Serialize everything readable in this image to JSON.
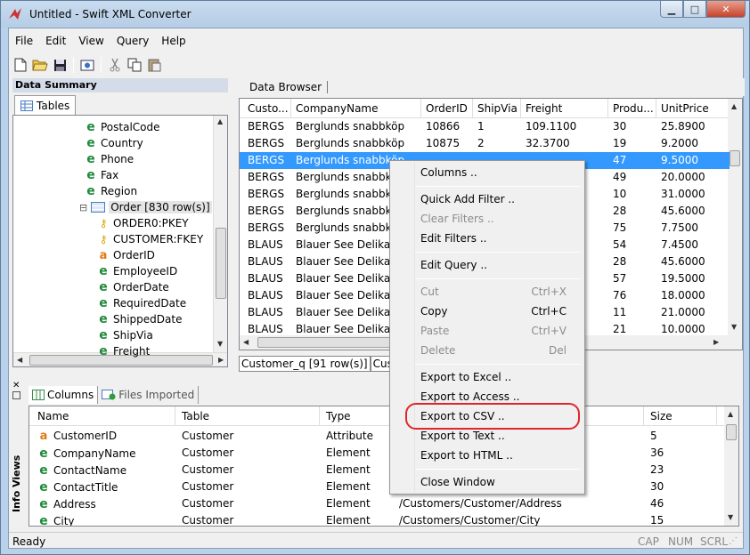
{
  "window": {
    "title": "Untitled - Swift XML Converter"
  },
  "menu": [
    "File",
    "Edit",
    "View",
    "Query",
    "Help"
  ],
  "left_panel": {
    "header": "Data Summary",
    "tab": "Tables",
    "tree": [
      {
        "icon": "element",
        "label": "PostalCode"
      },
      {
        "icon": "element",
        "label": "Country"
      },
      {
        "icon": "element",
        "label": "Phone"
      },
      {
        "icon": "element",
        "label": "Fax"
      },
      {
        "icon": "element",
        "label": "Region"
      },
      {
        "icon": "table",
        "label": "Order [830 row(s)]"
      },
      {
        "icon": "key",
        "label": "ORDER0:PKEY"
      },
      {
        "icon": "key",
        "label": "CUSTOMER:FKEY"
      },
      {
        "icon": "attribute",
        "label": "OrderID"
      },
      {
        "icon": "element",
        "label": "EmployeeID"
      },
      {
        "icon": "element",
        "label": "OrderDate"
      },
      {
        "icon": "element",
        "label": "RequiredDate"
      },
      {
        "icon": "element",
        "label": "ShippedDate"
      },
      {
        "icon": "element",
        "label": "ShipVia"
      },
      {
        "icon": "element",
        "label": "Freight"
      }
    ]
  },
  "data_browser": {
    "tab": "Data Browser",
    "columns": [
      "Custo...",
      "CompanyName",
      "OrderID",
      "ShipVia",
      "Freight",
      "Produ...",
      "UnitPrice"
    ],
    "rows": [
      [
        "BERGS",
        "Berglunds snabbköp",
        "10866",
        "1",
        "109.1100",
        "30",
        "25.8900"
      ],
      [
        "BERGS",
        "Berglunds snabbköp",
        "10875",
        "2",
        "32.3700",
        "19",
        "9.2000"
      ],
      [
        "BERGS",
        "Berglunds snabbköp",
        "",
        "",
        "",
        "47",
        "9.5000"
      ],
      [
        "BERGS",
        "Berglunds snabbköp",
        "",
        "",
        "",
        "49",
        "20.0000"
      ],
      [
        "BERGS",
        "Berglunds snabbköp",
        "",
        "",
        "",
        "10",
        "31.0000"
      ],
      [
        "BERGS",
        "Berglunds snabbköp",
        "",
        "",
        "",
        "28",
        "45.6000"
      ],
      [
        "BERGS",
        "Berglunds snabbköp",
        "",
        "",
        "",
        "75",
        "7.7500"
      ],
      [
        "BLAUS",
        "Blauer See Delikatess",
        "",
        "",
        "",
        "54",
        "7.4500"
      ],
      [
        "BLAUS",
        "Blauer See Delikatess",
        "",
        "",
        "",
        "28",
        "45.6000"
      ],
      [
        "BLAUS",
        "Blauer See Delikatess",
        "",
        "",
        "",
        "57",
        "19.5000"
      ],
      [
        "BLAUS",
        "Blauer See Delikatess",
        "",
        "",
        "",
        "76",
        "18.0000"
      ],
      [
        "BLAUS",
        "Blauer See Delikatess",
        "",
        "",
        "",
        "11",
        "21.0000"
      ],
      [
        "BLAUS",
        "Blauer See Delikatess",
        "",
        "",
        "",
        "21",
        "10.0000"
      ]
    ],
    "selected_row": 2,
    "bottom_tabs": [
      "Customer_q [91 row(s)]",
      "Customer"
    ]
  },
  "info_views": {
    "label": "Info Views",
    "tabs": [
      "Columns",
      "Files Imported"
    ],
    "columns": [
      "Name",
      "Table",
      "Type",
      "",
      "Size"
    ],
    "rows": [
      {
        "icon": "attribute",
        "name": "CustomerID",
        "table": "Customer",
        "type": "Attribute",
        "path": "",
        "size": "5"
      },
      {
        "icon": "element",
        "name": "CompanyName",
        "table": "Customer",
        "type": "Element",
        "path": "",
        "size": "36"
      },
      {
        "icon": "element",
        "name": "ContactName",
        "table": "Customer",
        "type": "Element",
        "path": "",
        "size": "23"
      },
      {
        "icon": "element",
        "name": "ContactTitle",
        "table": "Customer",
        "type": "Element",
        "path": "",
        "size": "30"
      },
      {
        "icon": "element",
        "name": "Address",
        "table": "Customer",
        "type": "Element",
        "path": "/Customers/Customer/Address",
        "size": "46"
      },
      {
        "icon": "element",
        "name": "City",
        "table": "Customer",
        "type": "Element",
        "path": "/Customers/Customer/City",
        "size": "15"
      }
    ]
  },
  "status": {
    "text": "Ready",
    "indicators": [
      "CAP",
      "NUM",
      "SCRL"
    ]
  },
  "context_menu": {
    "items": [
      {
        "label": "Columns ..",
        "shortcut": "",
        "enabled": true
      },
      {
        "sep": true
      },
      {
        "label": "Quick Add Filter ..",
        "shortcut": "",
        "enabled": true
      },
      {
        "label": "Clear Filters ..",
        "shortcut": "",
        "enabled": false
      },
      {
        "label": "Edit Filters ..",
        "shortcut": "",
        "enabled": true
      },
      {
        "sep": true
      },
      {
        "label": "Edit Query ..",
        "shortcut": "",
        "enabled": true
      },
      {
        "sep": true
      },
      {
        "label": "Cut",
        "shortcut": "Ctrl+X",
        "enabled": false
      },
      {
        "label": "Copy",
        "shortcut": "Ctrl+C",
        "enabled": true
      },
      {
        "label": "Paste",
        "shortcut": "Ctrl+V",
        "enabled": false
      },
      {
        "label": "Delete",
        "shortcut": "Del",
        "enabled": false
      },
      {
        "sep": true
      },
      {
        "label": "Export to Excel ..",
        "shortcut": "",
        "enabled": true
      },
      {
        "label": "Export to Access ..",
        "shortcut": "",
        "enabled": true
      },
      {
        "label": "Export to CSV ..",
        "shortcut": "",
        "enabled": true
      },
      {
        "label": "Export to Text ..",
        "shortcut": "",
        "enabled": true
      },
      {
        "label": "Export to HTML ..",
        "shortcut": "",
        "enabled": true
      },
      {
        "sep": true
      },
      {
        "label": "Close Window",
        "shortcut": "",
        "enabled": true
      }
    ],
    "highlighted": "Export to CSV .."
  },
  "colors": {
    "selection": "#3399ff",
    "highlight_ring": "#e0262c",
    "element_icon": "#1e8a3a",
    "attribute_icon": "#e07a10"
  }
}
